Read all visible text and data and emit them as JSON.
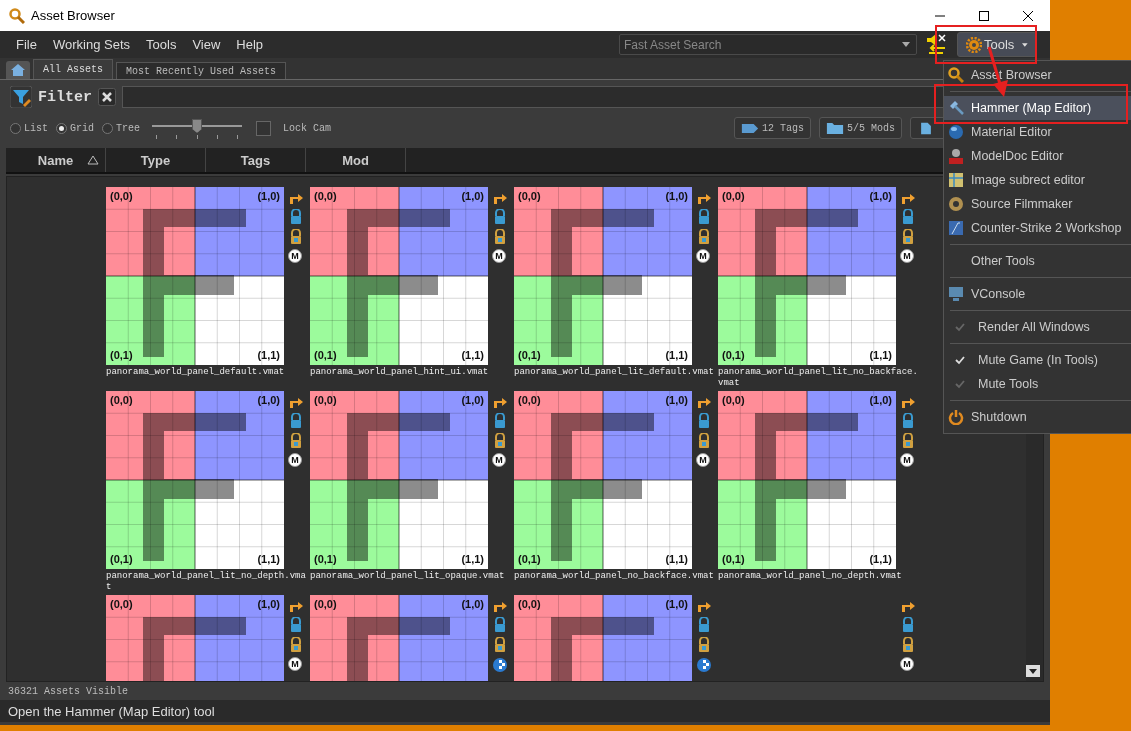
{
  "window": {
    "title": "Asset Browser"
  },
  "menu_bar": [
    "File",
    "Working Sets",
    "Tools",
    "View",
    "Help"
  ],
  "search": {
    "placeholder": "Fast Asset Search"
  },
  "tools_button": {
    "label": "Tools",
    "expanded": true
  },
  "tabs": [
    {
      "label": "All Assets",
      "selected": true
    },
    {
      "label": "Most Recently Used Assets",
      "selected": false
    }
  ],
  "filter": {
    "label": "Filter"
  },
  "view_modes": [
    {
      "label": "List",
      "selected": false
    },
    {
      "label": "Grid",
      "selected": true
    },
    {
      "label": "Tree",
      "selected": false
    }
  ],
  "zoom_slider": {
    "level": 0.5
  },
  "lock_cam": {
    "label": "Lock Cam",
    "checked": false
  },
  "filter_buttons": [
    "12 Tags",
    "5/5 Mods"
  ],
  "columns": [
    {
      "label": "Name",
      "sorted": true
    },
    {
      "label": "Type",
      "sorted": false
    },
    {
      "label": "Tags",
      "sorted": false
    },
    {
      "label": "Mod",
      "sorted": false
    }
  ],
  "assets": [
    {
      "name": "panorama_world_panel_default.vmat",
      "thumbnail": true,
      "labels": [
        "(0,0)",
        "(1,0)",
        "(0,1)",
        "(1,1)"
      ],
      "badge": "M"
    },
    {
      "name": "panorama_world_panel_hint_ui.vmat",
      "thumbnail": true,
      "labels": [
        "(0,0)",
        "(1,0)",
        "(0,1)",
        "(1,1)"
      ],
      "badge": "M"
    },
    {
      "name": "panorama_world_panel_lit_default.vmat",
      "thumbnail": true,
      "labels": [
        "(0,0)",
        "(1,0)",
        "(0,1)",
        "(1,1)"
      ],
      "badge": "M"
    },
    {
      "name": "panorama_world_panel_lit_no_backface.vmat",
      "thumbnail": true,
      "labels": [
        "(0,0)",
        "(1,0)",
        "(0,1)",
        "(1,1)"
      ],
      "badge": "M"
    },
    {
      "name": "panorama_world_panel_lit_no_depth.vmat",
      "thumbnail": true,
      "labels": [
        "(0,0)",
        "(1,0)",
        "(0,1)",
        "(1,1)"
      ],
      "badge": "M"
    },
    {
      "name": "panorama_world_panel_lit_opaque.vmat",
      "thumbnail": true,
      "labels": [
        "(0,0)",
        "(1,0)",
        "(0,1)",
        "(1,1)"
      ],
      "badge": "M"
    },
    {
      "name": "panorama_world_panel_no_backface.vmat",
      "thumbnail": true,
      "labels": [
        "(0,0)",
        "(1,0)",
        "(0,1)",
        "(1,1)"
      ],
      "badge": "M"
    },
    {
      "name": "panorama_world_panel_no_depth.vmat",
      "thumbnail": true,
      "labels": [
        "(0,0)",
        "(1,0)",
        "(0,1)",
        "(1,1)"
      ],
      "badge": "M"
    },
    {
      "thumbnail": true,
      "labels": [
        "(0,0)",
        "(1,0)"
      ],
      "badge": "M"
    },
    {
      "thumbnail": true,
      "labels": [
        "(0,0)",
        "(1,0)"
      ]
    },
    {
      "thumbnail": true,
      "labels": [
        "(0,0)",
        "(1,0)"
      ]
    },
    {
      "thumbnail": false,
      "badge": "M"
    }
  ],
  "footer": "36321 Assets Visible",
  "status_bar": "Open the Hammer (Map Editor) tool",
  "tools_menu": [
    {
      "kind": "item",
      "label": "Asset Browser",
      "selected": false
    },
    {
      "kind": "separator"
    },
    {
      "kind": "item",
      "label": "Hammer (Map Editor)",
      "selected": true
    },
    {
      "kind": "item",
      "label": "Material Editor",
      "selected": false
    },
    {
      "kind": "item",
      "label": "ModelDoc Editor",
      "selected": false
    },
    {
      "kind": "item",
      "label": "Image subrect editor",
      "selected": false
    },
    {
      "kind": "item",
      "label": "Source Filmmaker",
      "selected": false
    },
    {
      "kind": "item",
      "label": "Counter-Strike 2 Workshop",
      "selected": false
    },
    {
      "kind": "separator"
    },
    {
      "kind": "item",
      "label": "Other Tools",
      "selected": false
    },
    {
      "kind": "separator"
    },
    {
      "kind": "item",
      "label": "VConsole",
      "selected": false
    },
    {
      "kind": "separator"
    },
    {
      "kind": "check",
      "label": "Render All Windows",
      "checked": false
    },
    {
      "kind": "separator"
    },
    {
      "kind": "check",
      "label": "Mute Game (In Tools)",
      "checked": true
    },
    {
      "kind": "check",
      "label": "Mute Tools",
      "checked": false
    },
    {
      "kind": "separator"
    },
    {
      "kind": "item",
      "label": "Shutdown",
      "selected": false
    }
  ]
}
